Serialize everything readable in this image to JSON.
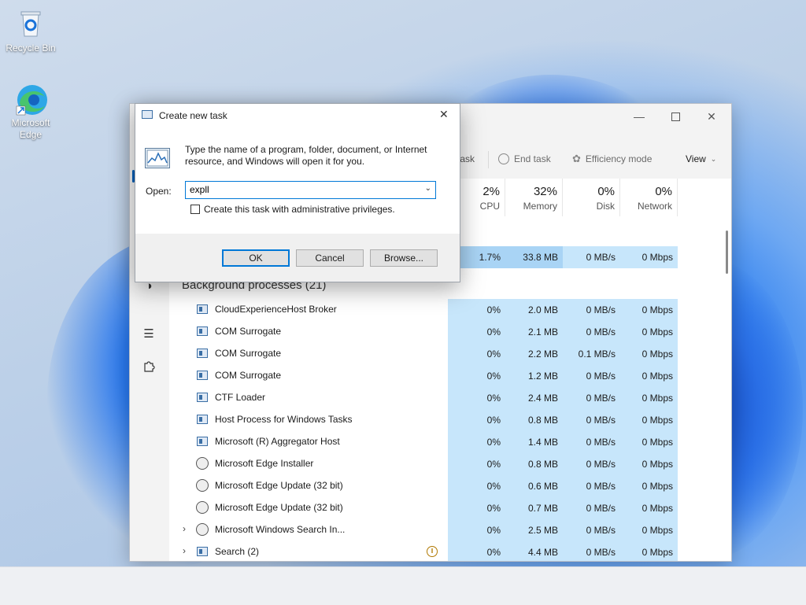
{
  "desktop": {
    "icons": [
      {
        "label": "Recycle Bin"
      },
      {
        "label": "Microsoft Edge"
      }
    ]
  },
  "task_manager": {
    "toolbar": {
      "run_task_label": "task",
      "end_task_label": "End task",
      "efficiency_label": "Efficiency mode",
      "view_label": "View"
    },
    "columns": [
      {
        "percent": "2%",
        "label": "CPU"
      },
      {
        "percent": "32%",
        "label": "Memory"
      },
      {
        "percent": "0%",
        "label": "Disk"
      },
      {
        "percent": "0%",
        "label": "Network"
      }
    ],
    "app_row": {
      "cpu": "1.7%",
      "memory": "33.8 MB",
      "disk": "0 MB/s",
      "network": "0 Mbps"
    },
    "section_title": "Background processes (21)",
    "processes": [
      {
        "name": "CloudExperienceHost Broker",
        "cpu": "0%",
        "memory": "2.0 MB",
        "disk": "0 MB/s",
        "network": "0 Mbps"
      },
      {
        "name": "COM Surrogate",
        "cpu": "0%",
        "memory": "2.1 MB",
        "disk": "0 MB/s",
        "network": "0 Mbps"
      },
      {
        "name": "COM Surrogate",
        "cpu": "0%",
        "memory": "2.2 MB",
        "disk": "0.1 MB/s",
        "network": "0 Mbps"
      },
      {
        "name": "COM Surrogate",
        "cpu": "0%",
        "memory": "1.2 MB",
        "disk": "0 MB/s",
        "network": "0 Mbps"
      },
      {
        "name": "CTF Loader",
        "cpu": "0%",
        "memory": "2.4 MB",
        "disk": "0 MB/s",
        "network": "0 Mbps"
      },
      {
        "name": "Host Process for Windows Tasks",
        "cpu": "0%",
        "memory": "0.8 MB",
        "disk": "0 MB/s",
        "network": "0 Mbps"
      },
      {
        "name": "Microsoft (R) Aggregator Host",
        "cpu": "0%",
        "memory": "1.4 MB",
        "disk": "0 MB/s",
        "network": "0 Mbps"
      },
      {
        "name": "Microsoft Edge Installer",
        "cpu": "0%",
        "memory": "0.8 MB",
        "disk": "0 MB/s",
        "network": "0 Mbps"
      },
      {
        "name": "Microsoft Edge Update (32 bit)",
        "cpu": "0%",
        "memory": "0.6 MB",
        "disk": "0 MB/s",
        "network": "0 Mbps"
      },
      {
        "name": "Microsoft Edge Update (32 bit)",
        "cpu": "0%",
        "memory": "0.7 MB",
        "disk": "0 MB/s",
        "network": "0 Mbps"
      },
      {
        "name": "Microsoft Windows Search In...",
        "cpu": "0%",
        "memory": "2.5 MB",
        "disk": "0 MB/s",
        "network": "0 Mbps"
      },
      {
        "name": "Search (2)",
        "cpu": "0%",
        "memory": "4.4 MB",
        "disk": "0 MB/s",
        "network": "0 Mbps"
      }
    ]
  },
  "dialog": {
    "title": "Create new task",
    "description": "Type the name of a program, folder, document, or Internet resource, and Windows will open it for you.",
    "open_label": "Open:",
    "open_value": "expll",
    "admin_checkbox_label": "Create this task with administrative privileges.",
    "admin_checked": false,
    "ok_label": "OK",
    "cancel_label": "Cancel",
    "browse_label": "Browse..."
  },
  "colors": {
    "accent": "#005fb8",
    "highlight_light": "#c7e6fb",
    "highlight_dark": "#a9d4f5"
  }
}
